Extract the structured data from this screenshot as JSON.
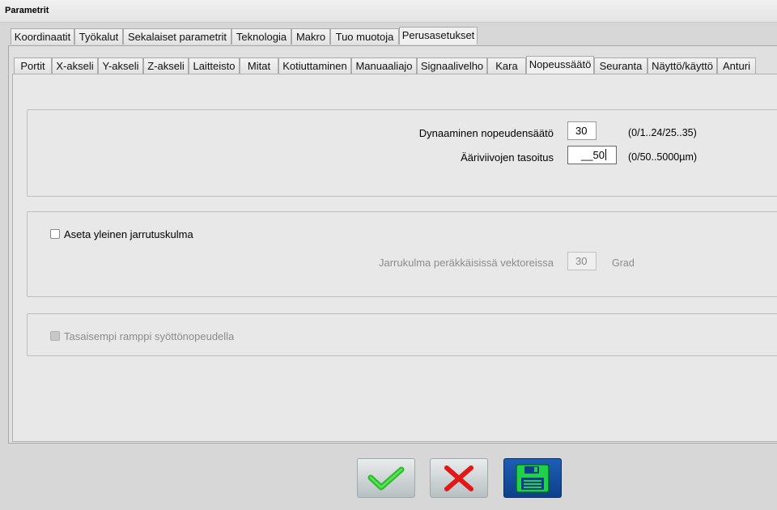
{
  "window": {
    "title": "Parametrit"
  },
  "top_tabs": [
    {
      "label": "Koordinaatit",
      "active": false
    },
    {
      "label": "Työkalut",
      "active": false
    },
    {
      "label": "Sekalaiset parametrit",
      "active": false
    },
    {
      "label": "Teknologia",
      "active": false
    },
    {
      "label": "Makro",
      "active": false
    },
    {
      "label": "Tuo muotoja",
      "active": false
    },
    {
      "label": "Perusasetukset",
      "active": true
    }
  ],
  "sub_tabs": [
    {
      "label": "Portit",
      "active": false
    },
    {
      "label": "X-akseli",
      "active": false
    },
    {
      "label": "Y-akseli",
      "active": false
    },
    {
      "label": "Z-akseli",
      "active": false
    },
    {
      "label": "Laitteisto",
      "active": false
    },
    {
      "label": "Mitat",
      "active": false
    },
    {
      "label": "Kotiuttaminen",
      "active": false
    },
    {
      "label": "Manuaaliajo",
      "active": false
    },
    {
      "label": "Signaalivelho",
      "active": false
    },
    {
      "label": "Kara",
      "active": false
    },
    {
      "label": "Nopeussäätö",
      "active": true
    },
    {
      "label": "Seuranta",
      "active": false
    },
    {
      "label": "Näyttö/käyttö",
      "active": false
    },
    {
      "label": "Anturi",
      "active": false
    }
  ],
  "speed_group": {
    "dynamic_label": "Dynaaminen nopeudensäätö",
    "dynamic_value": "30",
    "dynamic_hint": "(0/1..24/25..35)",
    "contour_label": "Ääriviivojen tasoitus",
    "contour_value": "__50",
    "contour_hint": "(0/50..5000µm)"
  },
  "brake_group": {
    "checkbox_label": "Aseta yleinen jarrutuskulma",
    "checked": false,
    "angle_label": "Jarrukulma peräkkäisissä vektoreissa",
    "angle_value": "30",
    "angle_unit": "Grad"
  },
  "ramp_group": {
    "checkbox_label": "Tasaisempi ramppi syöttönopeudella",
    "checked": false,
    "enabled": false
  },
  "buttons": {
    "ok_icon": "checkmark-icon",
    "cancel_icon": "close-icon",
    "save_icon": "floppy-disk-icon",
    "ok_color": "#2bbf2b",
    "cancel_color": "#e01818",
    "save_color": "#1d5fb6"
  }
}
